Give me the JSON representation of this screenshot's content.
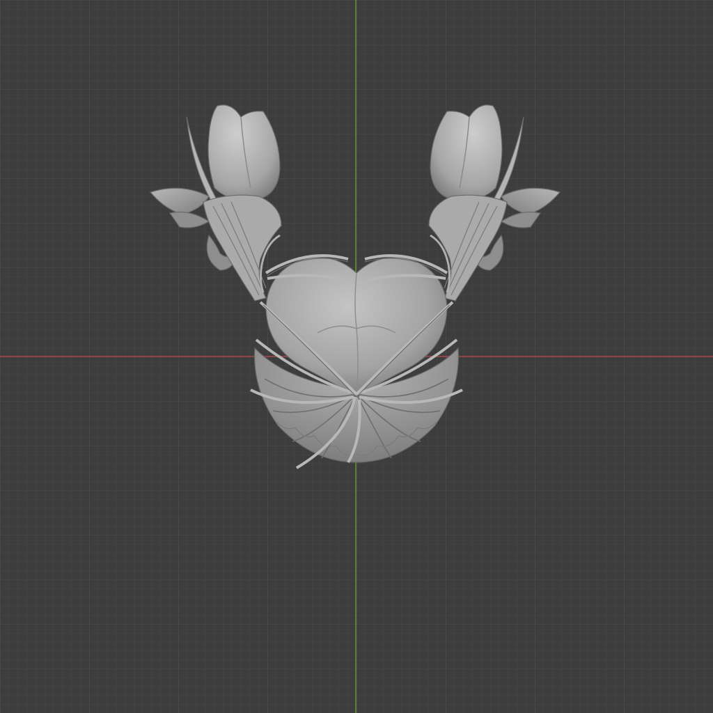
{
  "viewport": {
    "view": "front-orthographic",
    "background_color": "#3d3d3d",
    "grid": {
      "visible": true,
      "minor_line_color": "#474747",
      "major_line_color": "#505050"
    },
    "axes": {
      "x_axis_color": "#b0474e",
      "z_axis_color": "#6b9a2b"
    }
  },
  "scene_object": {
    "semantic": "sculpted-heart-bow-with-flower-buds",
    "material_color": "#9e9e9e",
    "shade_light": "#c4c4c4",
    "shade_dark": "#6e6e6e"
  }
}
